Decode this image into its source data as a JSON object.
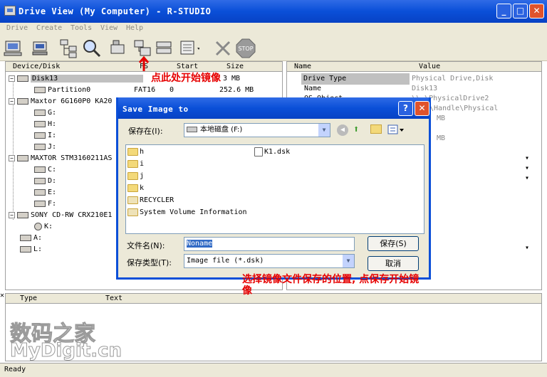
{
  "window": {
    "title": "Drive View (My Computer) - R-STUDIO",
    "min": "_",
    "max": "□",
    "close": "✕"
  },
  "menu": [
    "Drive",
    "Create",
    "Tools",
    "View",
    "Help"
  ],
  "left_pane": {
    "columns": [
      "Device/Disk",
      "FS",
      "Start",
      "Size"
    ],
    "rows": [
      {
        "label": "Disk13",
        "fs": "",
        "start": "",
        "size": "3 MB"
      },
      {
        "label": "Partition0",
        "fs": "FAT16",
        "start": "0",
        "size": "252.6 MB"
      },
      {
        "label": "Maxtor 6G160P0 KA20",
        "fs": "",
        "start": "",
        "size": ""
      },
      {
        "label": "G:"
      },
      {
        "label": "H:"
      },
      {
        "label": "I:"
      },
      {
        "label": "J:"
      },
      {
        "label": "MAXTOR STM3160211AS"
      },
      {
        "label": "C:"
      },
      {
        "label": "D:"
      },
      {
        "label": "E:"
      },
      {
        "label": "F:"
      },
      {
        "label": "SONY CD-RW CRX210E1"
      },
      {
        "label": "K:"
      },
      {
        "label": "A:"
      },
      {
        "label": "L:"
      }
    ]
  },
  "right_pane": {
    "columns": [
      "Name",
      "Value"
    ],
    "rows": [
      {
        "name": "Drive Type",
        "value": "Physical Drive,Disk"
      },
      {
        "name": "Name",
        "value": "Disk13"
      },
      {
        "name": "OS Object",
        "value": "\\\\.\\PhysicalDrive2"
      },
      {
        "name": "",
        "value": "\\Handle\\Physical"
      },
      {
        "name": "",
        "value": "MB"
      },
      {
        "name": "",
        "value": "MB"
      }
    ]
  },
  "log_pane": {
    "columns": [
      "Type",
      "Text"
    ]
  },
  "annotations": {
    "top": "点此处开始镜像",
    "bottom": "选择镜像文件保存的位置, 点保存开始镜像"
  },
  "dialog": {
    "title": "Save Image to",
    "help": "?",
    "close": "✕",
    "save_in_label": "保存在(I):",
    "save_in_value": "本地磁盘 (F:)",
    "files": [
      "h",
      "i",
      "j",
      "k",
      "RECYCLER",
      "System Volume Information",
      "K1.dsk"
    ],
    "filename_label": "文件名(N):",
    "filename_value": "Noname",
    "filetype_label": "保存类型(T):",
    "filetype_value": "Image file (*.dsk)",
    "save": "保存(S)",
    "cancel": "取消"
  },
  "status": "Ready",
  "watermark": {
    "cn": "数码之家",
    "en": "MyDigit.cn"
  }
}
